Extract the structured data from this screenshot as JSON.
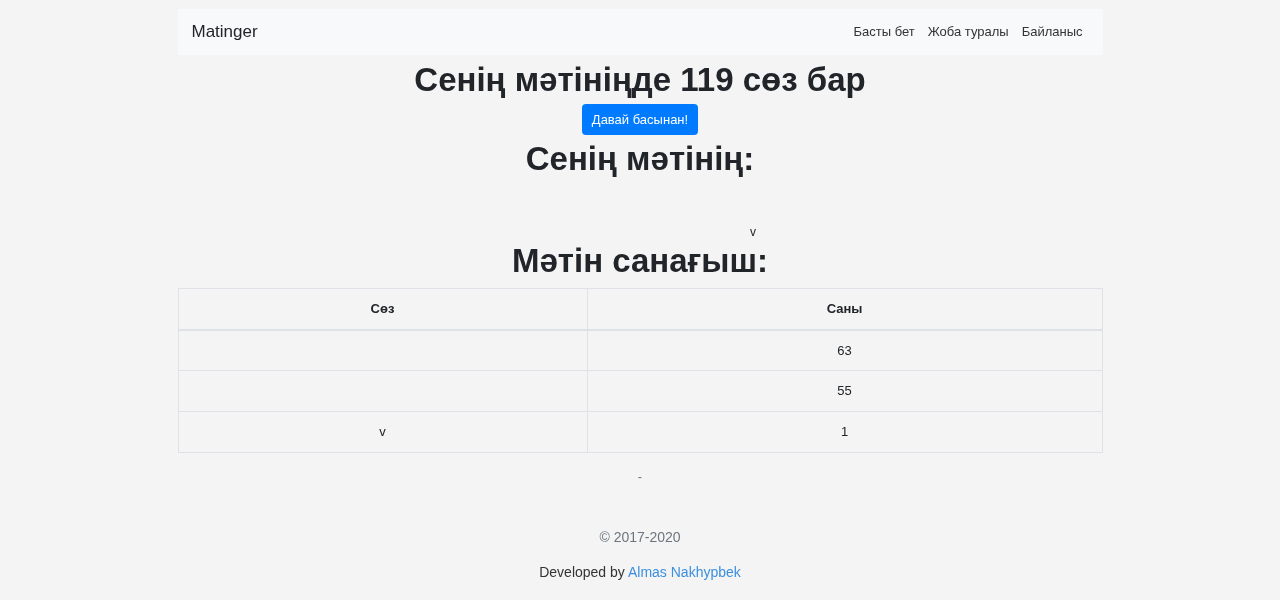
{
  "navbar": {
    "brand": "Matinger",
    "links": [
      "Басты бет",
      "Жоба туралы",
      "Байланыс"
    ]
  },
  "result_heading": "Сенің мәтініңде 119 сөз бар",
  "restart_button": "Давай басынан!",
  "text_heading": "Сенің мәтінің:",
  "text_body": "v",
  "counter_heading": "Мәтін санағыш:",
  "table": {
    "columns": [
      "Сөз",
      "Саны"
    ],
    "rows": [
      {
        "count": "63"
      },
      {
        "count": "55"
      },
      {
        "word": "v",
        "count": "1"
      }
    ]
  },
  "separator": "-",
  "footer": {
    "copyright": "© 2017-2020",
    "credit": "Developed by",
    "author": "Almas Nakhypbek"
  }
}
